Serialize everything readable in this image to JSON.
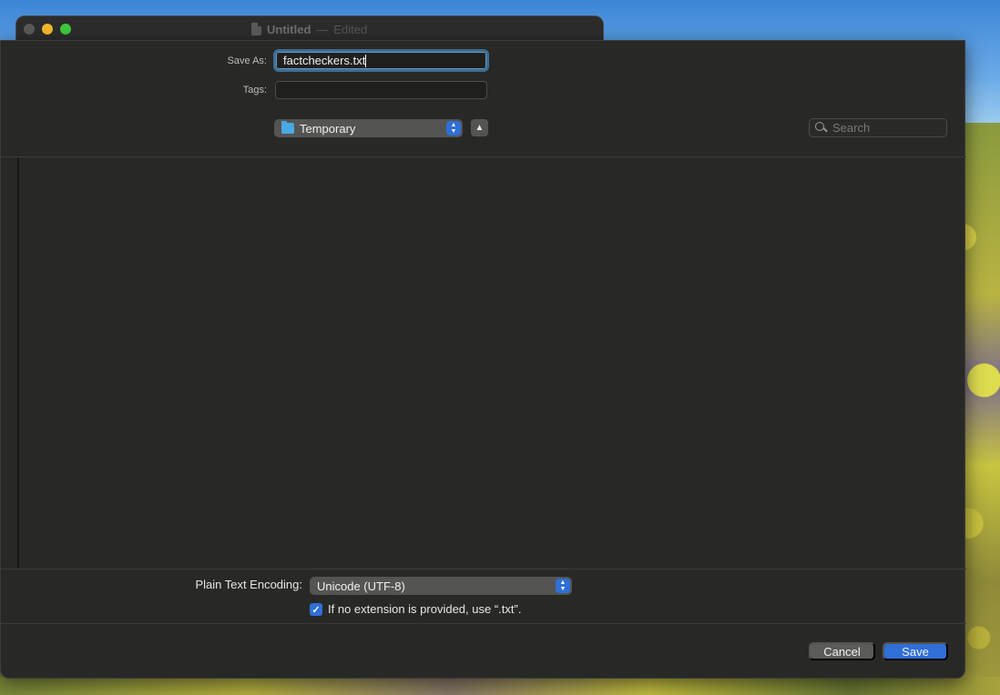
{
  "background_window": {
    "title": "Untitled",
    "separator": "—",
    "status": "Edited"
  },
  "save_panel": {
    "save_as_label": "Save As:",
    "save_as_value": "factcheckers.txt",
    "tags_label": "Tags:",
    "tags_value": "",
    "location": "Temporary",
    "search_placeholder": "Search"
  },
  "options": {
    "encoding_label": "Plain Text Encoding:",
    "encoding_value": "Unicode (UTF-8)",
    "extension_checkbox_label": "If no extension is provided, use “.txt”.",
    "extension_checked": true
  },
  "buttons": {
    "cancel": "Cancel",
    "save": "Save"
  },
  "colors": {
    "accent": "#2f6fd6",
    "panel_bg": "#282826",
    "focus_ring": "#3c6e94"
  }
}
